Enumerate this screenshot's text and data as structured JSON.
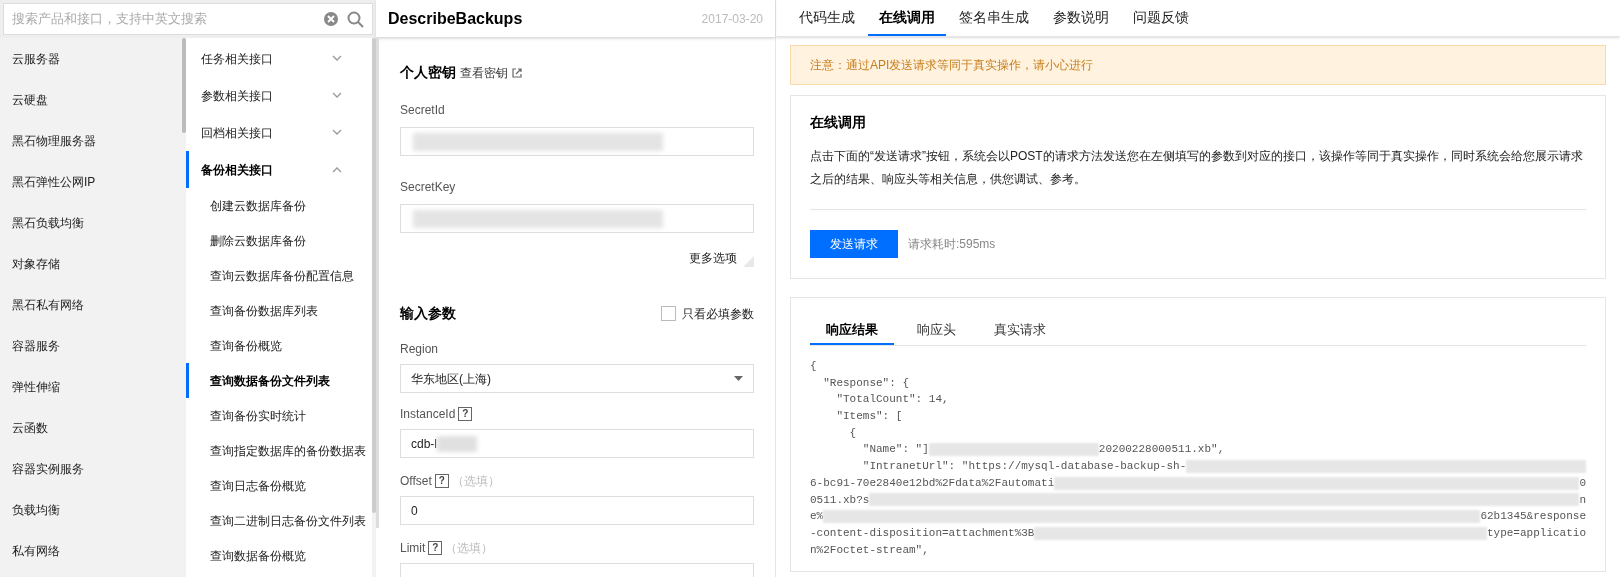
{
  "search": {
    "placeholder": "搜索产品和接口，支持中英文搜索"
  },
  "products": [
    {
      "label": "云服务器",
      "selected": false
    },
    {
      "label": "云硬盘",
      "selected": false
    },
    {
      "label": "黑石物理服务器",
      "selected": false
    },
    {
      "label": "黑石弹性公网IP",
      "selected": false
    },
    {
      "label": "黑石负载均衡",
      "selected": false
    },
    {
      "label": "对象存储",
      "selected": false
    },
    {
      "label": "黑石私有网络",
      "selected": false
    },
    {
      "label": "容器服务",
      "selected": false
    },
    {
      "label": "弹性伸缩",
      "selected": false
    },
    {
      "label": "云函数",
      "selected": false
    },
    {
      "label": "容器实例服务",
      "selected": false
    },
    {
      "label": "负载均衡",
      "selected": false
    },
    {
      "label": "私有网络",
      "selected": false
    }
  ],
  "api_groups": [
    {
      "label": "任务相关接口",
      "expanded": false,
      "selected": false
    },
    {
      "label": "参数相关接口",
      "expanded": false,
      "selected": false
    },
    {
      "label": "回档相关接口",
      "expanded": false,
      "selected": false
    },
    {
      "label": "备份相关接口",
      "expanded": true,
      "selected": true,
      "children": [
        {
          "label": "创建云数据库备份",
          "selected": false
        },
        {
          "label": "删除云数据库备份",
          "selected": false
        },
        {
          "label": "查询云数据库备份配置信息",
          "selected": false
        },
        {
          "label": "查询备份数据库列表",
          "selected": false
        },
        {
          "label": "查询备份概览",
          "selected": false
        },
        {
          "label": "查询数据备份文件列表",
          "selected": true
        },
        {
          "label": "查询备份实时统计",
          "selected": false
        },
        {
          "label": "查询指定数据库的备份数据表",
          "selected": false
        },
        {
          "label": "查询日志备份概览",
          "selected": false
        },
        {
          "label": "查询二进制日志备份文件列表",
          "selected": false
        },
        {
          "label": "查询数据备份概览",
          "selected": false
        }
      ]
    }
  ],
  "api": {
    "name": "DescribeBackups",
    "date": "2017-03-20"
  },
  "credentials": {
    "title": "个人密钥",
    "link": "查看密钥",
    "fields": [
      {
        "label": "SecretId"
      },
      {
        "label": "SecretKey"
      }
    ]
  },
  "more_options": "更多选项",
  "params": {
    "title": "输入参数",
    "required_only": {
      "label": "只看必填参数",
      "checked": false
    },
    "fields": [
      {
        "kind": "select",
        "label": "Region",
        "value": "华东地区(上海)"
      },
      {
        "kind": "text",
        "label": "InstanceId",
        "help": "?",
        "value": "cdb-l",
        "redacted": true
      },
      {
        "kind": "text",
        "label": "Offset",
        "help": "?",
        "optional": "（选填）",
        "value": "0",
        "redacted": false
      },
      {
        "kind": "text",
        "label": "Limit",
        "help": "?",
        "optional": "（选填）",
        "redacted": false
      }
    ]
  },
  "tabs": [
    {
      "label": "代码生成",
      "selected": false
    },
    {
      "label": "在线调用",
      "selected": true
    },
    {
      "label": "签名串生成",
      "selected": false
    },
    {
      "label": "参数说明",
      "selected": false
    },
    {
      "label": "问题反馈",
      "selected": false
    }
  ],
  "notice": "注意：通过API发送请求等同于真实操作，请小心进行",
  "online": {
    "title": "在线调用",
    "description": "点击下面的“发送请求”按钮，系统会以POST的请求方法发送您在左侧填写的参数到对应的接口，该操作等同于真实操作，同时系统会给您展示请求之后的结果、响应头等相关信息，供您调试、参考。",
    "button": "发送请求",
    "timing": "请求耗时:595ms"
  },
  "response": {
    "tabs": [
      {
        "label": "响应结果",
        "selected": true
      },
      {
        "label": "响应头",
        "selected": false
      },
      {
        "label": "真实请求",
        "selected": false
      }
    ],
    "lines": [
      [
        {
          "kind": "text",
          "text": "{"
        }
      ],
      [
        {
          "kind": "text",
          "text": "  \"Response\": {"
        }
      ],
      [
        {
          "kind": "text",
          "text": "    \"TotalCount\": 14,"
        }
      ],
      [
        {
          "kind": "text",
          "text": "    \"Items\": ["
        }
      ],
      [
        {
          "kind": "text",
          "text": "      {"
        }
      ],
      [
        {
          "kind": "text",
          "text": "        \"Name\": \"]"
        },
        {
          "kind": "redacted_short"
        },
        {
          "kind": "text",
          "text": "20200228000511.xb\","
        }
      ],
      [
        {
          "kind": "text",
          "text": "        \"IntranetUrl\": \"https://mysql-database-backup-sh-"
        },
        {
          "kind": "redacted"
        }
      ],
      [
        {
          "kind": "text",
          "text": "6-bc91-70e2840e12bd%2Fdata%2Fautomati"
        },
        {
          "kind": "redacted"
        },
        {
          "kind": "text",
          "text": "0"
        }
      ],
      [
        {
          "kind": "text",
          "text": "0511.xb?s"
        },
        {
          "kind": "redacted"
        },
        {
          "kind": "text",
          "text": "n"
        }
      ],
      [
        {
          "kind": "text",
          "text": "e%"
        },
        {
          "kind": "redacted"
        },
        {
          "kind": "text",
          "text": "62b1345&response"
        }
      ],
      [
        {
          "kind": "text",
          "text": "-content-disposition=attachment%3B"
        },
        {
          "kind": "redacted"
        },
        {
          "kind": "text",
          "text": "type=applicatio"
        }
      ],
      [
        {
          "kind": "text",
          "text": "n%2Foctet-stream\","
        }
      ]
    ]
  }
}
